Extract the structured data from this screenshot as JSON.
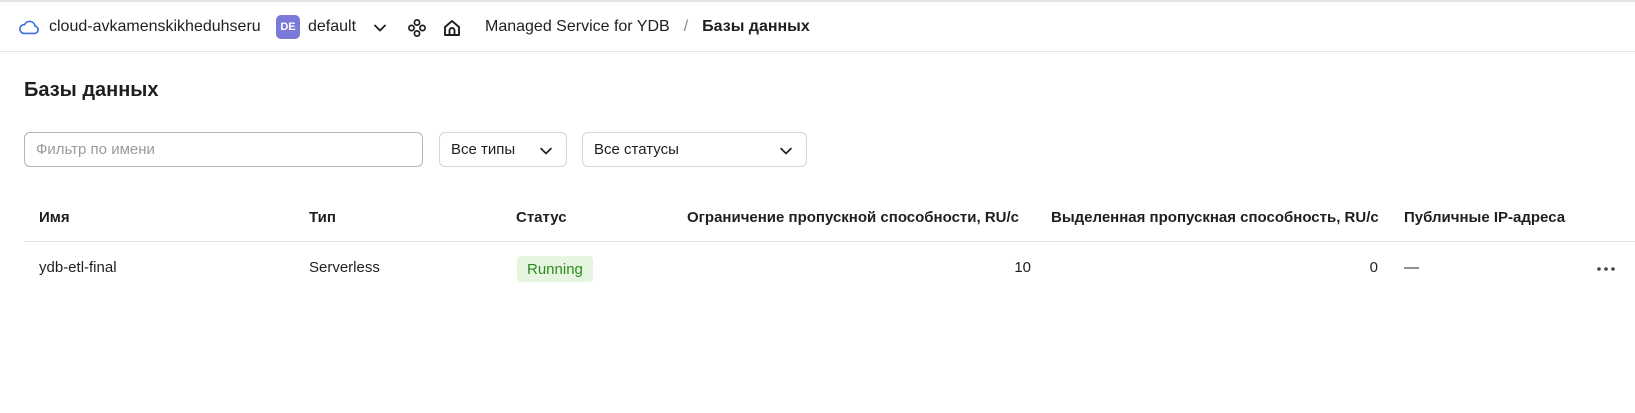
{
  "header": {
    "cloud_icon": "cloud-icon",
    "cloud_name": "cloud-avkamenskikheduhseru",
    "folder_badge": "DE",
    "folder_name": "default",
    "breadcrumb": {
      "service": "Managed Service for YDB",
      "separator": "/",
      "current": "Базы данных"
    }
  },
  "page": {
    "title": "Базы данных"
  },
  "filters": {
    "name_placeholder": "Фильтр по имени",
    "name_value": "",
    "type_selected": "Все типы",
    "status_selected": "Все статусы"
  },
  "table": {
    "columns": {
      "name": "Имя",
      "type": "Тип",
      "status": "Статус",
      "throughput_limit": "Ограничение пропускной способности, RU/с",
      "provisioned_throughput": "Выделенная пропускная способность, RU/с",
      "public_ips": "Публичные IP-адреса"
    },
    "rows": [
      {
        "name": "ydb-etl-final",
        "type": "Serverless",
        "status": "Running",
        "throughput_limit": "10",
        "provisioned_throughput": "0",
        "public_ips": "—"
      }
    ]
  },
  "colors": {
    "folder_badge": "#7b79d8",
    "status_running_bg": "#e5f5df",
    "status_running_text": "#2e8a1f",
    "cloud_icon": "#3b6fe0"
  }
}
